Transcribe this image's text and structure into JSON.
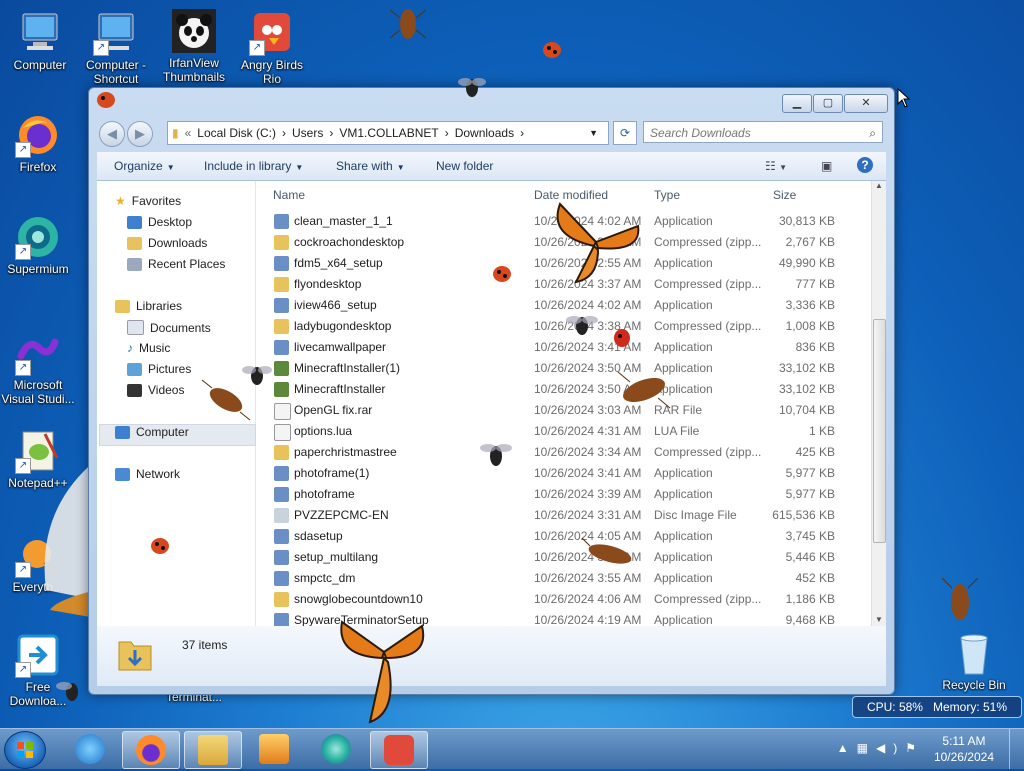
{
  "desktop_icons": [
    {
      "label": "Computer"
    },
    {
      "label": "Computer - Shortcut"
    },
    {
      "label": "IrfanView Thumbnails"
    },
    {
      "label": "Angry Birds Rio"
    },
    {
      "label": "Firefox"
    },
    {
      "label": "Supermium"
    },
    {
      "label": "Microsoft Visual Studi..."
    },
    {
      "label": "Notepad++"
    },
    {
      "label": "Everyth..."
    },
    {
      "label": "Free Downloa..."
    },
    {
      "label": "Terminat..."
    },
    {
      "label": "Recycle Bin"
    }
  ],
  "explorer": {
    "breadcrumb": [
      "Local Disk (C:)",
      "Users",
      "VM1.COLLABNET",
      "Downloads"
    ],
    "search_placeholder": "Search Downloads",
    "toolbar": {
      "organize": "Organize",
      "include": "Include in library",
      "share": "Share with",
      "new_folder": "New folder"
    },
    "nav": {
      "favorites": "Favorites",
      "desktop": "Desktop",
      "downloads": "Downloads",
      "recent": "Recent Places",
      "libraries": "Libraries",
      "documents": "Documents",
      "music": "Music",
      "pictures": "Pictures",
      "videos": "Videos",
      "computer": "Computer",
      "network": "Network"
    },
    "columns": {
      "name": "Name",
      "date": "Date modified",
      "type": "Type",
      "size": "Size"
    },
    "files": [
      {
        "name": "clean_master_1_1",
        "date": "10/26/2024 4:02 AM",
        "type": "Application",
        "size": "30,813 KB",
        "icon": "app-icon"
      },
      {
        "name": "cockroachondesktop",
        "date": "10/26/2024 3:36 AM",
        "type": "Compressed (zipp...",
        "size": "2,767 KB",
        "icon": "zip-icon"
      },
      {
        "name": "fdm5_x64_setup",
        "date": "10/26/2024 2:55 AM",
        "type": "Application",
        "size": "49,990 KB",
        "icon": "app-icon"
      },
      {
        "name": "flyondesktop",
        "date": "10/26/2024 3:37 AM",
        "type": "Compressed (zipp...",
        "size": "777 KB",
        "icon": "zip-icon"
      },
      {
        "name": "iview466_setup",
        "date": "10/26/2024 4:02 AM",
        "type": "Application",
        "size": "3,336 KB",
        "icon": "app-icon"
      },
      {
        "name": "ladybugondesktop",
        "date": "10/26/2024 3:38 AM",
        "type": "Compressed (zipp...",
        "size": "1,008 KB",
        "icon": "zip-icon"
      },
      {
        "name": "livecamwallpaper",
        "date": "10/26/2024 3:41 AM",
        "type": "Application",
        "size": "836 KB",
        "icon": "app-icon"
      },
      {
        "name": "MinecraftInstaller(1)",
        "date": "10/26/2024 3:50 AM",
        "type": "Application",
        "size": "33,102 KB",
        "icon": "minecraft-icon"
      },
      {
        "name": "MinecraftInstaller",
        "date": "10/26/2024 3:50 AM",
        "type": "Application",
        "size": "33,102 KB",
        "icon": "minecraft-icon"
      },
      {
        "name": "OpenGL fix.rar",
        "date": "10/26/2024 3:03 AM",
        "type": "RAR File",
        "size": "10,704 KB",
        "icon": "file-icon"
      },
      {
        "name": "options.lua",
        "date": "10/26/2024 4:31 AM",
        "type": "LUA File",
        "size": "1 KB",
        "icon": "file-icon"
      },
      {
        "name": "paperchristmastree",
        "date": "10/26/2024 3:34 AM",
        "type": "Compressed (zipp...",
        "size": "425 KB",
        "icon": "zip-icon"
      },
      {
        "name": "photoframe(1)",
        "date": "10/26/2024 3:41 AM",
        "type": "Application",
        "size": "5,977 KB",
        "icon": "app-icon"
      },
      {
        "name": "photoframe",
        "date": "10/26/2024 3:39 AM",
        "type": "Application",
        "size": "5,977 KB",
        "icon": "app-icon"
      },
      {
        "name": "PVZZEPCMC-EN",
        "date": "10/26/2024 3:31 AM",
        "type": "Disc Image File",
        "size": "615,536 KB",
        "icon": "disc-icon"
      },
      {
        "name": "sdasetup",
        "date": "10/26/2024 4:05 AM",
        "type": "Application",
        "size": "3,745 KB",
        "icon": "app-icon"
      },
      {
        "name": "setup_multilang",
        "date": "10/26/2024 3:53 AM",
        "type": "Application",
        "size": "5,446 KB",
        "icon": "app-icon"
      },
      {
        "name": "smpctc_dm",
        "date": "10/26/2024 3:55 AM",
        "type": "Application",
        "size": "452 KB",
        "icon": "app-icon"
      },
      {
        "name": "snowglobecountdown10",
        "date": "10/26/2024 4:06 AM",
        "type": "Compressed (zipp...",
        "size": "1,186 KB",
        "icon": "zip-icon"
      },
      {
        "name": "SpywareTerminatorSetup",
        "date": "10/26/2024 4:19 AM",
        "type": "Application",
        "size": "9,468 KB",
        "icon": "app-icon"
      }
    ],
    "status_count": "37 items"
  },
  "monitor": {
    "cpu": "CPU: 58%",
    "memory": "Memory: 51%"
  },
  "clock": {
    "time": "5:11 AM",
    "date": "10/26/2024"
  },
  "colors": {
    "folder": "#e8c25a",
    "app": "#6a8fc6",
    "selection": "#e5eaf1"
  }
}
